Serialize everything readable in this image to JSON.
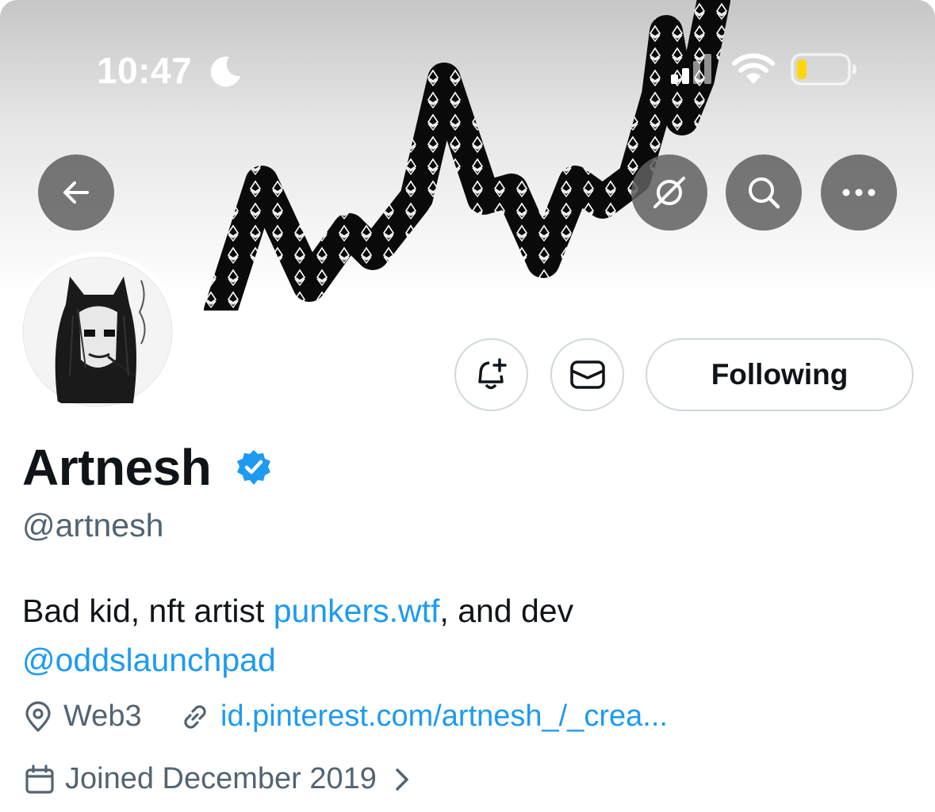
{
  "status_bar": {
    "time": "10:47",
    "icons": [
      "moon-icon",
      "cellular-signal-icon",
      "wifi-icon",
      "battery-icon"
    ]
  },
  "header_actions": {
    "icons": [
      "back-arrow-icon",
      "translate-off-icon",
      "search-icon",
      "more-icon"
    ]
  },
  "profile": {
    "name": "Artnesh",
    "handle": "@artnesh",
    "verified": true,
    "bio": {
      "part1": "Bad kid, nft artist ",
      "link1": "punkers.wtf",
      "part2": ", and dev",
      "mention": "@oddslaunchpad"
    },
    "location": "Web3",
    "website": "id.pinterest.com/artnesh_/_crea...",
    "joined": "Joined December 2019"
  },
  "actions": {
    "following_label": "Following",
    "icons": [
      "bell-plus-icon",
      "envelope-icon"
    ]
  },
  "colors": {
    "link": "#1d9bf0",
    "verified": "#1d9bf0",
    "secondary_text": "#536471",
    "header_button": "#5f5f5f",
    "battery_level": "#ffd60a"
  }
}
